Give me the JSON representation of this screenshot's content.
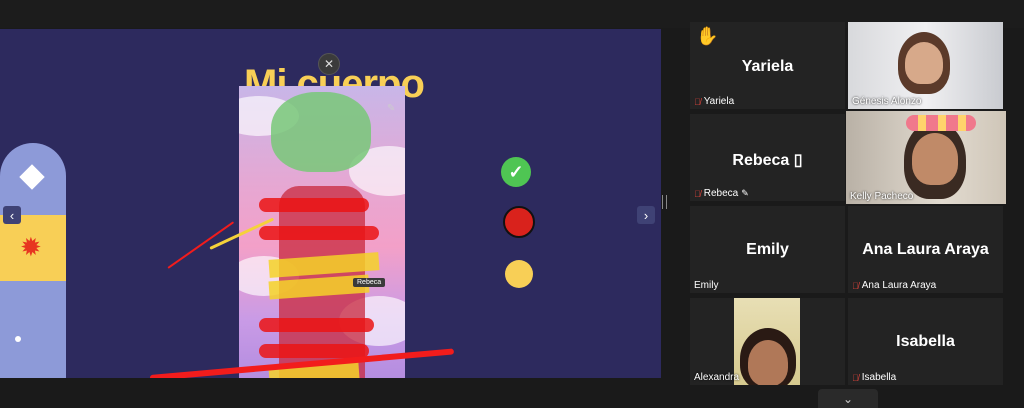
{
  "share": {
    "title": "Mi cuerpo",
    "annotator_tag": "Rebeca",
    "close_glyph": "✕",
    "prev_glyph": "‹",
    "next_glyph": "›",
    "check_glyph": "✓"
  },
  "gallery": {
    "tiles": [
      {
        "name": "Yariela",
        "label": "Yariela",
        "muted": true,
        "hand_raised": true,
        "video": false
      },
      {
        "name": "",
        "label": "Génesis Alonzo",
        "muted": false,
        "video": true
      },
      {
        "name": "Rebeca ▯",
        "label": "Rebeca",
        "muted": true,
        "video": false
      },
      {
        "name": "",
        "label": "Kelly Pacheco",
        "muted": false,
        "video": true,
        "active_speaker": true
      },
      {
        "name": "Emily",
        "label": "Emily",
        "muted": false,
        "video": false
      },
      {
        "name": "Ana Laura Araya",
        "label": "Ana Laura Araya",
        "muted": true,
        "video": false
      },
      {
        "name": "",
        "label": "Alexandra",
        "muted": false,
        "video": true
      },
      {
        "name": "Isabella",
        "label": "Isabella",
        "muted": true,
        "video": false
      }
    ],
    "more_glyph": "⌄"
  },
  "colors": {
    "slide_bg": "#2d2a5e",
    "title_yellow": "#f8cf56",
    "check_green": "#4fc553",
    "stop_red": "#d9221c",
    "annotation_red": "#f21c1c",
    "active_outline": "#d5d27a"
  }
}
